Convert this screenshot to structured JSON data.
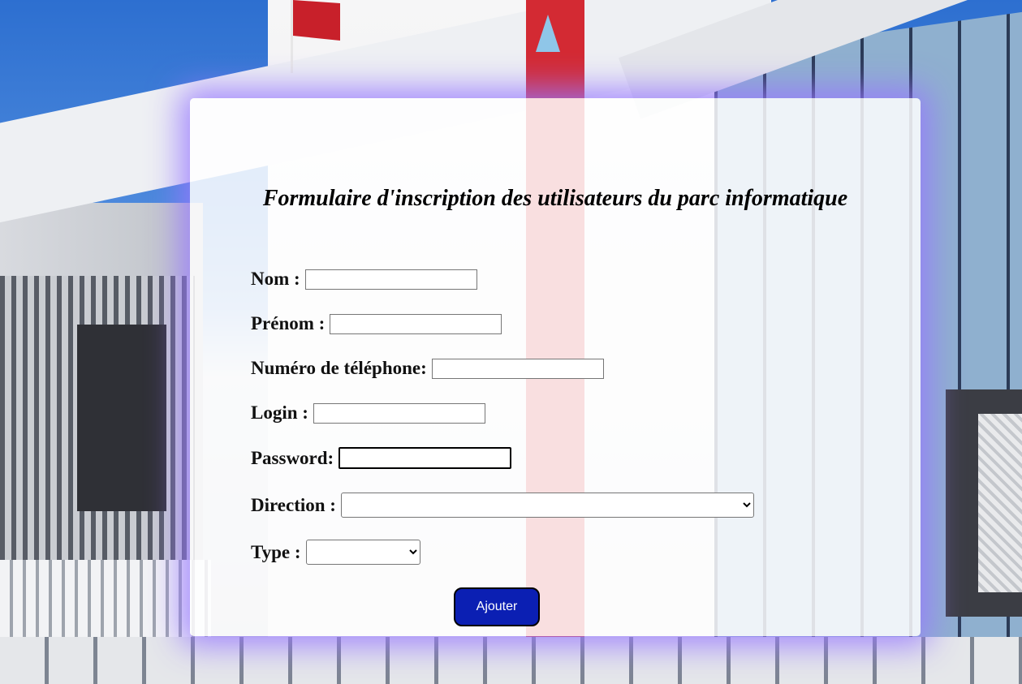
{
  "form": {
    "title": "Formulaire d'inscription des utilisateurs du parc informatique",
    "fields": {
      "nom": {
        "label": "Nom :",
        "value": ""
      },
      "prenom": {
        "label": "Prénom :",
        "value": ""
      },
      "telephone": {
        "label": "Numéro de téléphone:",
        "value": ""
      },
      "login": {
        "label": "Login :",
        "value": ""
      },
      "password": {
        "label": "Password:",
        "value": ""
      },
      "direction": {
        "label": "Direction :",
        "selected": ""
      },
      "type": {
        "label": "Type :",
        "selected": ""
      }
    },
    "submit_label": "Ajouter"
  },
  "colors": {
    "button_bg": "#0b1fb3",
    "card_glow": "#9678ff"
  }
}
